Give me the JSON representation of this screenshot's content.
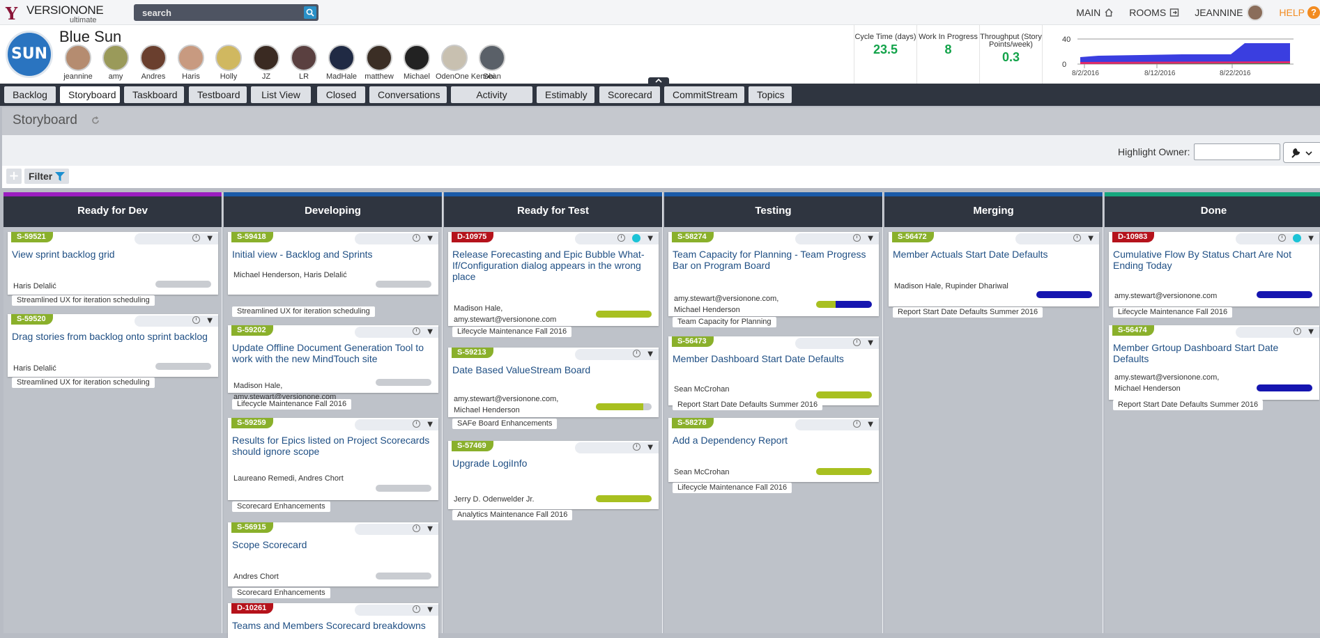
{
  "app": {
    "brand": "VERSIONONE",
    "edition": "ultimate"
  },
  "search": {
    "placeholder": "search"
  },
  "topnav": {
    "main": "MAIN",
    "rooms": "ROOMS",
    "user": "JEANNINE",
    "help": "HELP",
    "help_badge": "?"
  },
  "project": {
    "name": "Blue Sun",
    "logo_text": "SUN",
    "members": [
      "jeannine",
      "amy",
      "Andres",
      "Haris",
      "Holly",
      "JZ",
      "LR",
      "MadHale",
      "matthew",
      "Michael",
      "OdenOne Kenobi",
      "Sean"
    ]
  },
  "metrics": [
    {
      "label": "Cycle Time (days)",
      "value": "23.5"
    },
    {
      "label": "Work In Progress",
      "value": "8"
    },
    {
      "label": "Throughput (Story Points/week)",
      "value": "0.3"
    }
  ],
  "chart_data": {
    "type": "area",
    "x": [
      "8/2/2016",
      "8/12/2016",
      "8/22/2016"
    ],
    "y_ticks": [
      0,
      40
    ],
    "ylim": [
      0,
      40
    ],
    "series_colors": [
      "#3a3ee0",
      "#e02a6a",
      "#18a34a"
    ]
  },
  "tabs": [
    "Backlog",
    "Storyboard",
    "Taskboard",
    "Testboard",
    "List View",
    "Closed",
    "Conversations",
    "Activity Stream",
    "Estimably",
    "Scorecard",
    "CommitStream",
    "Topics"
  ],
  "active_tab": "Storyboard",
  "page": {
    "title": "Storyboard",
    "highlight_owner_label": "Highlight Owner:",
    "highlight_owner_value": "",
    "filter_label": "Filter"
  },
  "colors": {
    "story": "#8ab02b",
    "defect": "#b5121b",
    "progress_green": "#a8c020",
    "progress_blue": "#1515b0",
    "progress_gray": "#c9ccd1"
  },
  "columns": [
    {
      "title": "Ready for Dev",
      "stripe": "#9b1ec0",
      "cards": [
        {
          "id": "S-59521",
          "kind": "story",
          "title": "View sprint backlog grid",
          "owner": "Haris Delalić",
          "progress": 0,
          "tag": "Streamlined UX for iteration scheduling"
        },
        {
          "id": "S-59520",
          "kind": "story",
          "title": "Drag stories from backlog onto sprint backlog",
          "owner": "Haris Delalić",
          "progress": 0,
          "tag": "Streamlined UX for iteration scheduling"
        }
      ]
    },
    {
      "title": "Developing",
      "stripe": "#1a5aa8",
      "cards": [
        {
          "id": "S-59418",
          "kind": "story",
          "title": "Initial view - Backlog and Sprints",
          "owner": "Michael Henderson, Haris Delalić",
          "progress": 0,
          "tag": "Streamlined UX for iteration scheduling"
        },
        {
          "id": "S-59202",
          "kind": "story",
          "title": "Update Offline Document Generation Tool to work with the new MindTouch site",
          "owner": "Madison Hale, amy.stewart@versionone.com",
          "progress": 0,
          "tag": "Lifecycle Maintenance Fall 2016"
        },
        {
          "id": "S-59259",
          "kind": "story",
          "title": "Results for Epics listed on Project Scorecards should ignore scope",
          "owner": "Laureano Remedi, Andres Chort",
          "progress": 0,
          "tag": "Scorecard Enhancements"
        },
        {
          "id": "S-56915",
          "kind": "story",
          "title": "Scope Scorecard",
          "owner": "Andres Chort",
          "progress": 0,
          "tag": "Scorecard Enhancements"
        },
        {
          "id": "D-10261",
          "kind": "defect",
          "title": "Teams and Members Scorecard breakdowns",
          "owner": "",
          "progress": 0,
          "tag": ""
        }
      ]
    },
    {
      "title": "Ready for Test",
      "stripe": "#1a5aa8",
      "cards": [
        {
          "id": "D-10975",
          "kind": "defect",
          "title": "Release Forecasting and Epic Bubble What-If/Configuration dialog appears in the wrong place",
          "owner": "Madison Hale, amy.stewart@versionone.com",
          "progress": 1,
          "tag": "Lifecycle Maintenance Fall 2016",
          "dot": true
        },
        {
          "id": "S-59213",
          "kind": "story",
          "title": "Date Based ValueStream Board",
          "owner": "amy.stewart@versionone.com, Michael Henderson",
          "progress": 0.85,
          "tag": "SAFe Board Enhancements"
        },
        {
          "id": "S-57469",
          "kind": "story",
          "title": "Upgrade LogiInfo",
          "owner": "Jerry D. Odenwelder Jr.",
          "progress": 1,
          "tag": "Analytics Maintenance Fall 2016"
        }
      ]
    },
    {
      "title": "Testing",
      "stripe": "#1a5aa8",
      "cards": [
        {
          "id": "S-58274",
          "kind": "story",
          "title": "Team Capacity for Planning - Team Progress Bar on Program Board",
          "owner": "amy.stewart@versionone.com, Michael Henderson",
          "progress": 1,
          "split": true,
          "tag": "Team Capacity for Planning"
        },
        {
          "id": "S-56473",
          "kind": "story",
          "title": "Member Dashboard Start Date Defaults",
          "owner": "Sean McCrohan",
          "progress": 1,
          "tag": "Report Start Date Defaults Summer 2016"
        },
        {
          "id": "S-58278",
          "kind": "story",
          "title": "Add a Dependency Report",
          "owner": "Sean McCrohan",
          "progress": 1,
          "tag": "Lifecycle Maintenance Fall 2016"
        }
      ]
    },
    {
      "title": "Merging",
      "stripe": "#1a5aa8",
      "cards": [
        {
          "id": "S-56472",
          "kind": "story",
          "title": "Member Actuals Start Date Defaults",
          "owner": "Madison Hale, Rupinder Dhariwal",
          "progress": 1,
          "blue": true,
          "tag": "Report Start Date Defaults Summer 2016"
        }
      ]
    },
    {
      "title": "Done",
      "stripe": "#16a77e",
      "cards": [
        {
          "id": "D-10983",
          "kind": "defect",
          "title": "Cumulative Flow By Status Chart Are Not Ending Today",
          "owner": "amy.stewart@versionone.com",
          "progress": 1,
          "blue": true,
          "tag": "Lifecycle Maintenance Fall 2016",
          "dot": true
        },
        {
          "id": "S-56474",
          "kind": "story",
          "title": "Member Grtoup Dashboard Start Date Defaults",
          "owner": "amy.stewart@versionone.com, Michael Henderson",
          "progress": 1,
          "blue": true,
          "tag": "Report Start Date Defaults Summer 2016"
        }
      ]
    }
  ]
}
